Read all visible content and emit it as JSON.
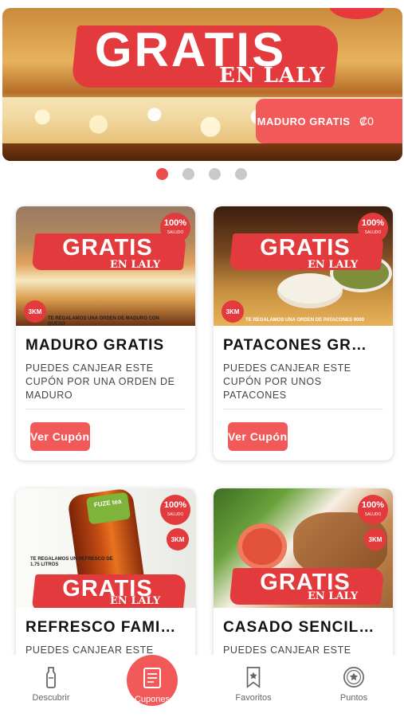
{
  "hero": {
    "big_text": "GRATIS",
    "script_text": "EN LALY",
    "pill_label": "MADURO GRATIS",
    "pill_value": "₡0"
  },
  "carousel": {
    "count": 4,
    "active": 0
  },
  "cards": [
    {
      "title": "MADURO GRATIS",
      "description": "PUEDES CANJEAR ESTE CUPÓN POR UNA ORDEN DE MADURO",
      "button": "Ver Cupón",
      "img_big": "GRATIS",
      "img_script": "EN LALY",
      "badge": "100%",
      "km": "3KM",
      "fine": "TE REGALAMOS UNA ORDEN DE MADURO CON QUESO"
    },
    {
      "title": "PATACONES GR…",
      "description": "PUEDES CANJEAR ESTE CUPÓN POR UNOS PATACONES",
      "button": "Ver Cupón",
      "img_big": "GRATIS",
      "img_script": "EN LALY",
      "badge": "100%",
      "km": "3KM",
      "fine": "TE REGALAMOS UNA ORDEN DE PATACONES 9000"
    },
    {
      "title": "REFRESCO FAMI…",
      "description": "PUEDES CANJEAR ESTE",
      "img_big": "GRATIS",
      "img_script": "EN LALY",
      "badge": "100%",
      "km": "3KM",
      "label": "FUZE tea",
      "fine": "TE REGALAMOS UN REFRESCO DE 1.75 LITROS"
    },
    {
      "title": "CASADO SENCIL…",
      "description": "PUEDES CANJEAR ESTE",
      "img_big": "GRATIS",
      "img_script": "EN LALY",
      "badge": "100%",
      "km": "3KM"
    }
  ],
  "nav": {
    "items": [
      {
        "label": "Descubrir",
        "icon": "bottle-icon"
      },
      {
        "label": "Cupones",
        "icon": "coupon-icon"
      },
      {
        "label": "Favoritos",
        "icon": "bookmark-star-icon"
      },
      {
        "label": "Puntos",
        "icon": "star-circle-icon"
      }
    ],
    "active": 1
  },
  "colors": {
    "accent": "#f25a5a",
    "brand_red": "#e23a3d",
    "dot_inactive": "#c9c9c9"
  }
}
